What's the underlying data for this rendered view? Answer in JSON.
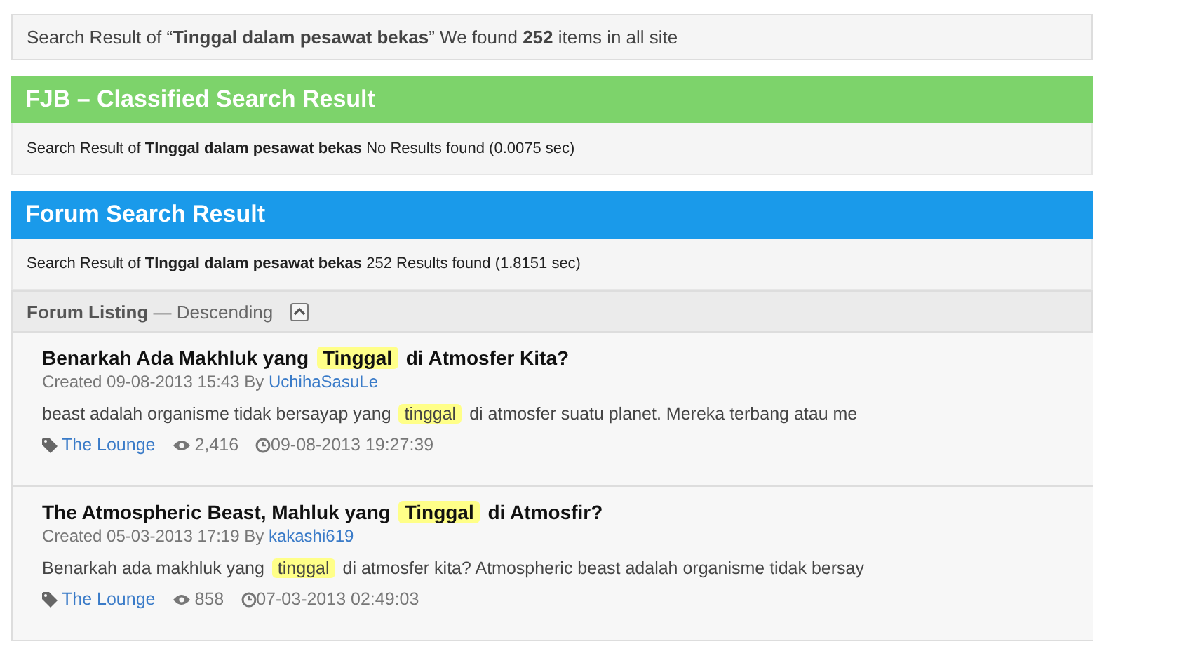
{
  "summary": "Search Result of “**Tinggal dalam pesawat bekas**” We found **252** items in all site",
  "sections": [
    {
      "kind": "classified",
      "title": "FJB – Classified Search Result",
      "result": "Search Result of **TInggal dalam pesawat bekas**  No Results found (0.0075 sec)"
    },
    {
      "kind": "forum",
      "title": "Forum Search Result",
      "result": "Search Result of **TInggal dalam pesawat bekas** 252 Results found (1.8151 sec)"
    }
  ],
  "listing": {
    "label": "Forum Listing",
    "order": "— Descending"
  },
  "threads": [
    {
      "title": [
        {
          "text": "Benarkah Ada Makhluk yang ",
          "highlight": false
        },
        {
          "text": "Tinggal",
          "highlight": true
        },
        {
          "text": " di Atmosfer Kita?",
          "highlight": false
        }
      ],
      "created": "Created 09-08-2013 15:43 By ",
      "author": "UchihaSasuLe",
      "snippet": [
        {
          "text": "beast adalah organisme tidak bersayap yang ",
          "highlight": false
        },
        {
          "text": "tinggal",
          "highlight": true
        },
        {
          "text": " di atmosfer suatu planet. Mereka terbang atau me",
          "highlight": false
        }
      ],
      "forum": "The Lounge",
      "views": "2,416",
      "last_post": "09-08-2013 19:27:39"
    },
    {
      "title": [
        {
          "text": "The Atmospheric Beast, Mahluk yang ",
          "highlight": false
        },
        {
          "text": "Tinggal",
          "highlight": true
        },
        {
          "text": " di Atmosfir?",
          "highlight": false
        }
      ],
      "created": "Created 05-03-2013 17:19 By ",
      "author": "kakashi619",
      "snippet": [
        {
          "text": "Benarkah ada makhluk yang ",
          "highlight": false
        },
        {
          "text": "tinggal",
          "highlight": true
        },
        {
          "text": " di atmosfer kita? Atmospheric beast adalah organisme tidak bersay",
          "highlight": false
        }
      ],
      "forum": "The Lounge",
      "views": "858",
      "last_post": "07-03-2013 02:49:03"
    }
  ]
}
